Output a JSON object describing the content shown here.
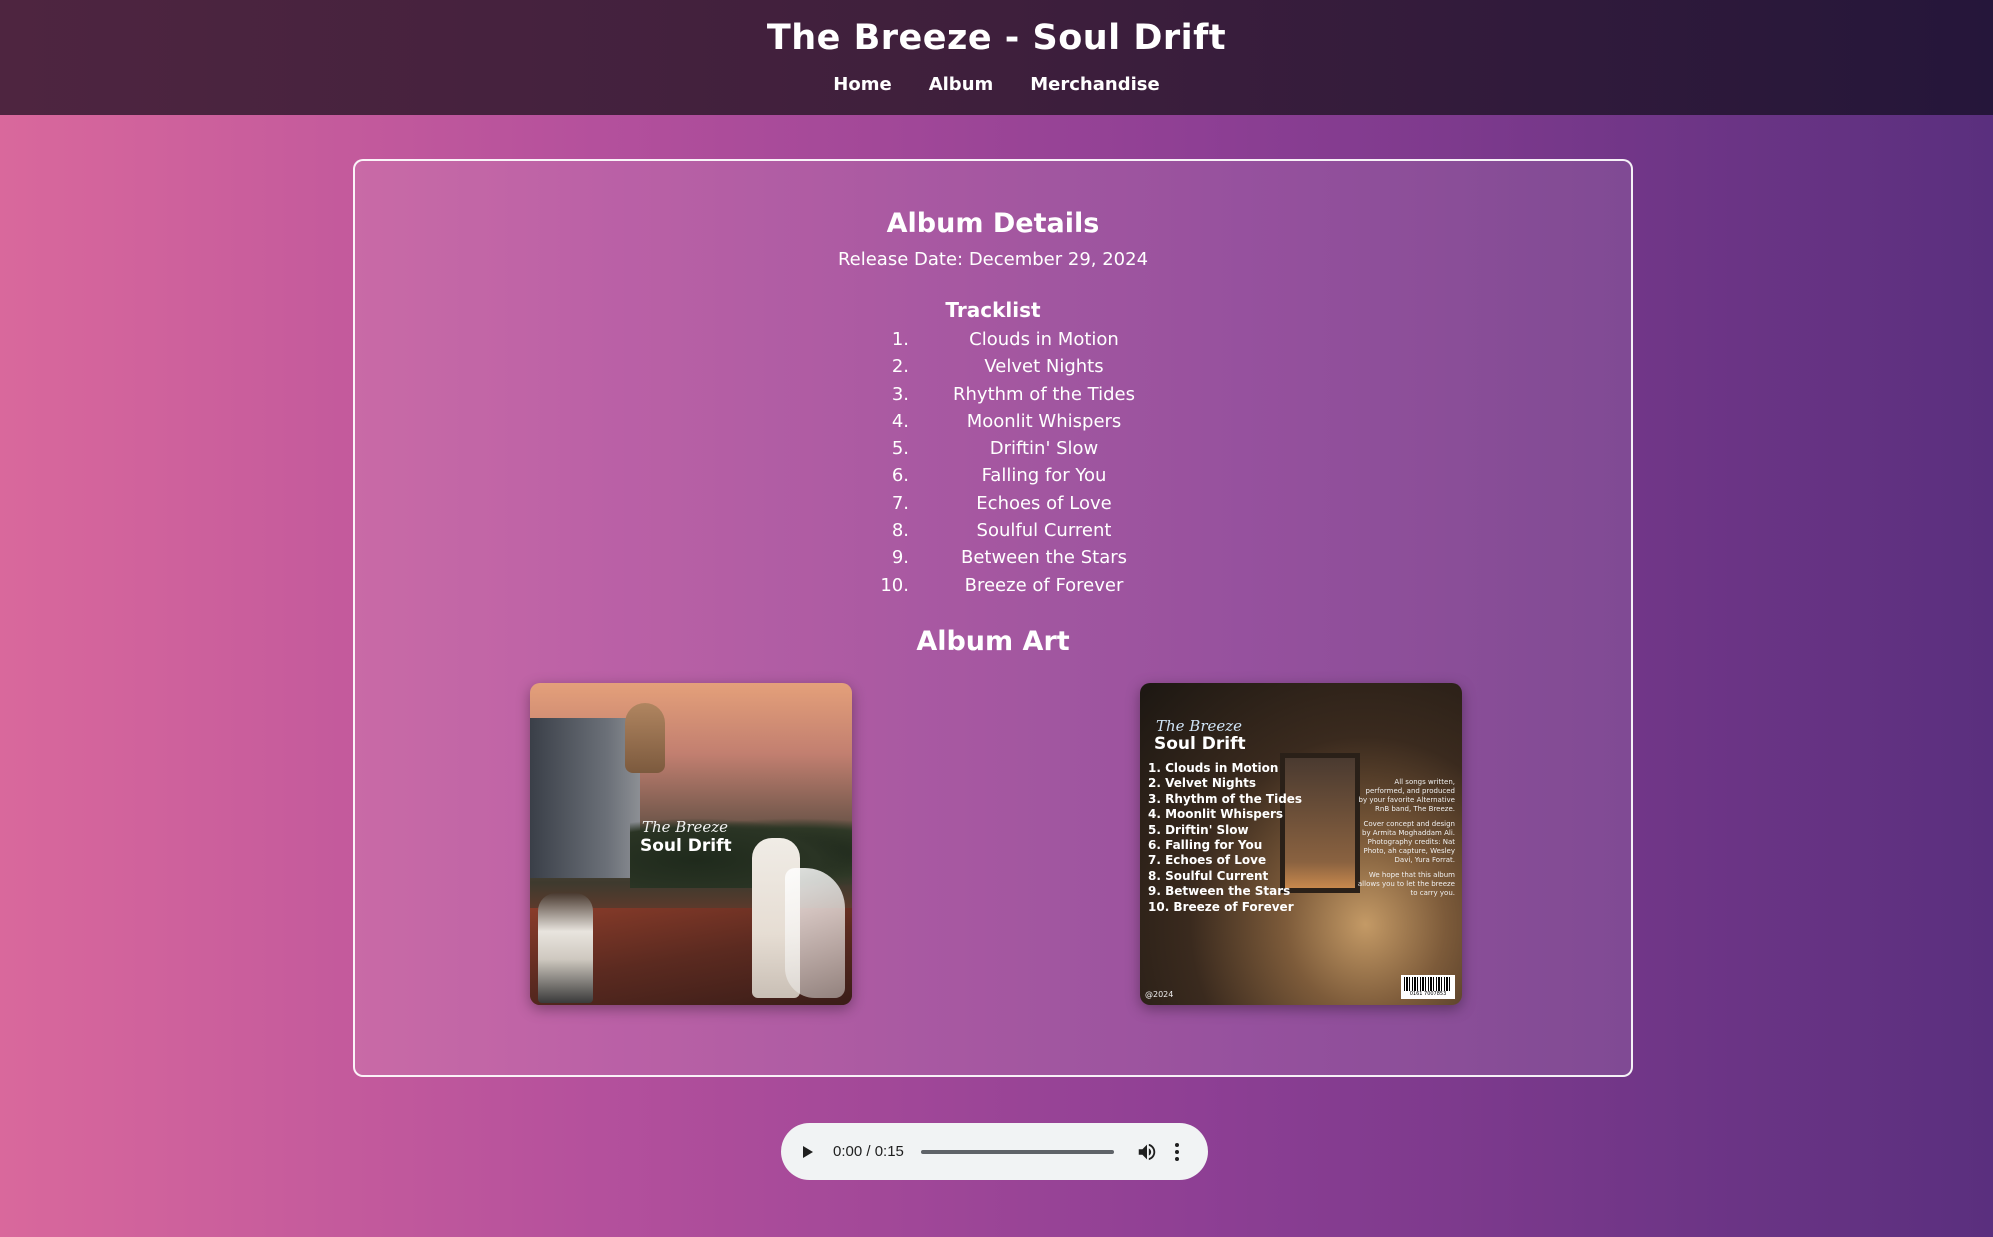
{
  "header": {
    "title": "The Breeze - Soul Drift",
    "nav": [
      "Home",
      "Album",
      "Merchandise"
    ]
  },
  "details": {
    "heading": "Album Details",
    "release_date": "Release Date: December 29, 2024",
    "tracklist_heading": "Tracklist",
    "tracks": [
      {
        "num": "1.",
        "title": "Clouds in Motion"
      },
      {
        "num": "2.",
        "title": "Velvet Nights"
      },
      {
        "num": "3.",
        "title": "Rhythm of the Tides"
      },
      {
        "num": "4.",
        "title": "Moonlit Whispers"
      },
      {
        "num": "5.",
        "title": "Driftin' Slow"
      },
      {
        "num": "6.",
        "title": "Falling for You"
      },
      {
        "num": "7.",
        "title": "Echoes of Love"
      },
      {
        "num": "8.",
        "title": "Soulful Current"
      },
      {
        "num": "9.",
        "title": "Between the Stars"
      },
      {
        "num": "10.",
        "title": "Breeze of Forever"
      }
    ]
  },
  "album_art": {
    "heading": "Album Art",
    "front": {
      "brand": "The Breeze",
      "album": "Soul Drift"
    },
    "back": {
      "brand": "The Breeze",
      "album": "Soul Drift",
      "tracks": [
        "1. Clouds in Motion",
        "2. Velvet Nights",
        "3. Rhythm of the Tides",
        "4. Moonlit Whispers",
        "5. Driftin' Slow",
        "6. Falling for You",
        "7. Echoes of Love",
        "8. Soulful Current",
        "9. Between the Stars",
        "10. Breeze of Forever"
      ],
      "credits": [
        "All songs written, performed, and produced by your favorite Alternative RnB band, The Breeze.",
        "Cover concept and design by Armita Moghaddam Ali. Photography credits: Nat Photo, ah capture, Wesley Davi, Yura Forrat.",
        "We hope that this album allows you to let the breeze to carry you."
      ],
      "year": "@2024",
      "barcode_digits": "0161 7007853"
    }
  },
  "player": {
    "time": "0:00 / 0:15",
    "progress": 0.0
  },
  "colors": {
    "header_bg": "#3e1f3c",
    "page_gradient_start": "#d9689c",
    "page_gradient_end": "#5a2f7e",
    "player_bg": "#f1f3f4"
  },
  "icons": [
    "play-icon",
    "volume-icon",
    "more-options-icon"
  ]
}
